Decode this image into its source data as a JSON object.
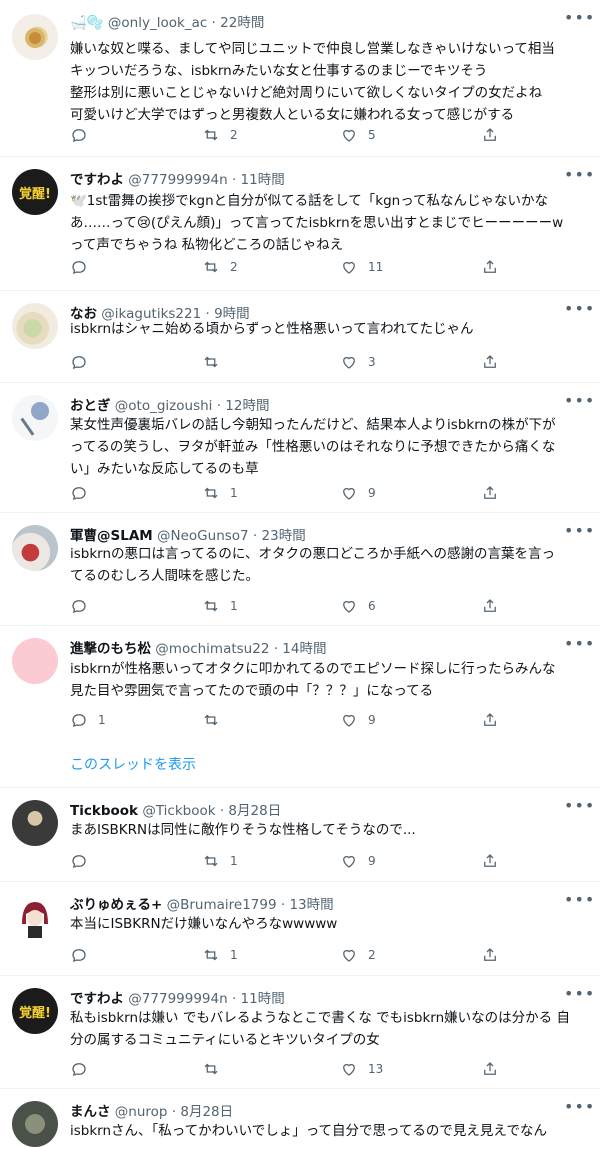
{
  "tweets": [
    {
      "name": "🛁🫧",
      "handle": "@only_look_ac",
      "time": "22時間",
      "lines": [
        "嫌いな奴と喋る、ましてや同じユニットで仲良し営業しなきゃいけないって相当",
        "キッついだろうな、isbkrnみたいな女と仕事するのまじーでキツそう",
        "整形は別に悪いことじゃないけど絶対周りにいて欲しくないタイプの女だよね",
        "可愛いけど大学ではずっと男複数人といる女に嫌われる女って感じがする"
      ],
      "replies": "",
      "retweets": "2",
      "likes": "5"
    },
    {
      "name": "ですわよ",
      "handle": "@777999994n",
      "time": "11時間",
      "lines": [
        "🕊️1st雷舞の挨拶でkgnと自分が似てる話をして「kgnって私なんじゃないかな",
        "あ……って😢(ぴえん顔)」って言ってたisbkrnを思い出すとまじでヒーーーーーw",
        "って声でちゃうね 私物化どころの話じゃねえ"
      ],
      "replies": "",
      "retweets": "2",
      "likes": "11"
    },
    {
      "name": "なお",
      "handle": "@ikagutiks221",
      "time": "9時間",
      "lines": [
        "isbkrnはシャニ始める頃からずっと性格悪いって言われてたじゃん"
      ],
      "replies": "",
      "retweets": "",
      "likes": "3"
    },
    {
      "name": "おとぎ",
      "handle": "@oto_gizoushi",
      "time": "12時間",
      "lines": [
        "某女性声優裏垢バレの話し今朝知ったんだけど、結果本人よりisbkrnの株が下が",
        "ってるの笑うし、ヲタが軒並み「性格悪いのはそれなりに予想できたから痛くな",
        "い」みたいな反応してるのも草"
      ],
      "replies": "",
      "retweets": "1",
      "likes": "9"
    },
    {
      "name": "軍曹@SLAM",
      "handle": "@NeoGunso7",
      "time": "23時間",
      "lines": [
        "isbkrnの悪口は言ってるのに、オタクの悪口どころか手紙への感謝の言葉を言っ",
        "てるのむしろ人間味を感じた。"
      ],
      "replies": "",
      "retweets": "1",
      "likes": "6"
    },
    {
      "name": "進撃のもち松",
      "handle": "@mochimatsu22",
      "time": "14時間",
      "lines": [
        "isbkrnが性格悪いってオタクに叩かれてるのでエピソード探しに行ったらみんな",
        "見た目や雰囲気で言ってたので頭の中「？？？」になってる"
      ],
      "replies": "1",
      "retweets": "",
      "likes": "9"
    },
    {
      "name": "Tickbook",
      "handle": "@Tickbook",
      "time": "8月28日",
      "lines": [
        "まあISBKRNは同性に敵作りそうな性格してそうなので..."
      ],
      "replies": "",
      "retweets": "1",
      "likes": "9"
    },
    {
      "name": "ぶりゅめぇる+",
      "handle": "@Brumaire1799",
      "time": "13時間",
      "lines": [
        "本当にISBKRNだけ嫌いなんやろなwwwww"
      ],
      "replies": "",
      "retweets": "1",
      "likes": "2"
    },
    {
      "name": "ですわよ",
      "handle": "@777999994n",
      "time": "11時間",
      "lines": [
        "私もisbkrnは嫌い でもバレるようなとこで書くな でもisbkrn嫌いなのは分かる 自",
        "分の属するコミュニティにいるとキツいタイプの女"
      ],
      "replies": "",
      "retweets": "",
      "likes": "13"
    },
    {
      "name": "まんさ",
      "handle": "@nurop",
      "time": "8月28日",
      "lines": [
        "isbkrnさん、「私ってかわいいでしょ」って自分で思ってるので見え見えでなん"
      ],
      "replies": "",
      "retweets": "",
      "likes": ""
    }
  ],
  "thread_link": "このスレッドを表示",
  "colors": {
    "accent": "#1d9bf0",
    "muted": "#536471",
    "text": "#0f1419",
    "divider": "#eff3f4"
  }
}
